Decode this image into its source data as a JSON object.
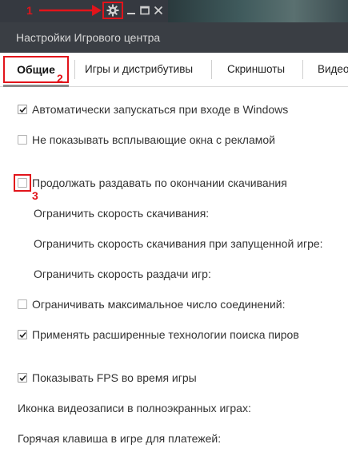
{
  "annotations": {
    "step1": "1",
    "step2": "2",
    "step3": "3",
    "accent_color": "#e2141b"
  },
  "window": {
    "title": "Настройки Игрового центра",
    "controls": [
      "settings-gear",
      "minimize",
      "maximize",
      "close"
    ]
  },
  "tabs": [
    {
      "label": "Общие",
      "active": true
    },
    {
      "label": "Игры и дистрибутивы",
      "active": false
    },
    {
      "label": "Скриншоты",
      "active": false
    },
    {
      "label": "Видео",
      "active": false
    }
  ],
  "settings": {
    "autostart": {
      "label": "Автоматически запускаться при входе в Windows",
      "checked": true
    },
    "no_ads": {
      "label": "Не показывать всплывающие окна с рекламой",
      "checked": false
    },
    "keep_seeding": {
      "label": "Продолжать раздавать по окончании скачивания",
      "checked": false
    },
    "limit_download": "Ограничить скорость скачивания:",
    "limit_download_ingame": "Ограничить скорость скачивания при запущенной игре:",
    "limit_upload": "Ограничить скорость раздачи игр:",
    "limit_connections": {
      "label": "Ограничивать максимальное число соединений:",
      "checked": false
    },
    "peer_search": {
      "label": "Применять расширенные технологии поиска пиров",
      "checked": true
    },
    "show_fps": {
      "label": "Показывать FPS во время игры",
      "checked": true
    },
    "video_icon": "Иконка видеозаписи в полноэкранных играх:",
    "payment_hotkey": "Горячая клавиша в игре для платежей:"
  }
}
